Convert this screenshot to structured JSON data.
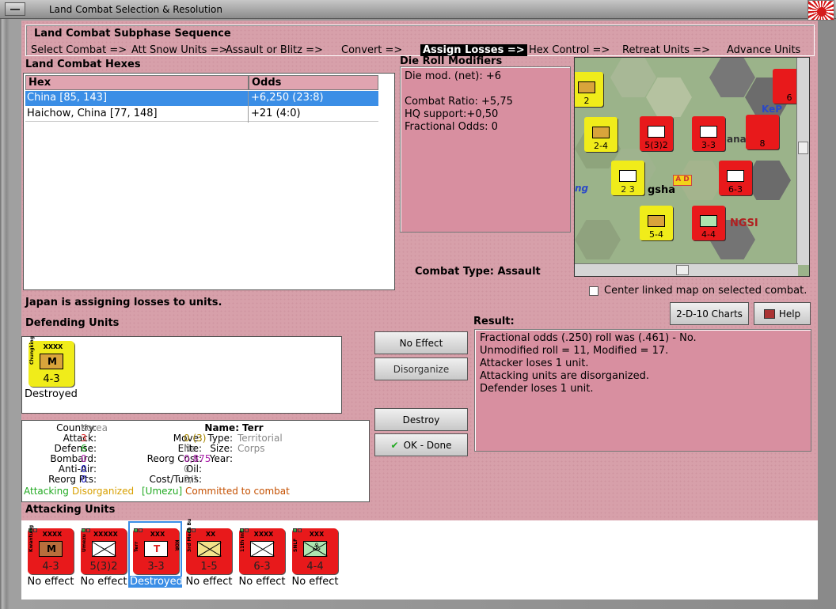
{
  "window": {
    "title": "Land Combat Selection & Resolution"
  },
  "sequence": {
    "title": "Land Combat Subphase Sequence",
    "steps": [
      "Select Combat =>",
      "Att Snow Units =>",
      "Assault or Blitz =>",
      "Convert =>",
      "Assign Losses =>",
      "Hex Control =>",
      "Retreat Units =>",
      "Advance Units"
    ],
    "active_index": 4
  },
  "hexes": {
    "title": "Land Combat Hexes",
    "columns": [
      "Hex",
      "Odds"
    ],
    "rows": [
      {
        "hex": "China [85, 143]",
        "odds": "+6,250 (23:8)"
      },
      {
        "hex": "Haichow, China [77, 148]",
        "odds": "+21 (4:0)"
      }
    ]
  },
  "die_roll": {
    "title": "Die Roll Modifiers",
    "lines": [
      "Die mod. (net): +6",
      "",
      "Combat Ratio: +5,75",
      "HQ support:+0,50",
      "Fractional Odds: 0"
    ]
  },
  "combat_type": {
    "label": "Combat Type:",
    "value": "Assault"
  },
  "center_map": {
    "label": "Center linked map on selected combat."
  },
  "status_message": "Japan is assigning losses to units.",
  "defending": {
    "title": "Defending Units",
    "units": [
      {
        "name": "Chungking",
        "size": "XXXX",
        "strength": "4-3",
        "state": "Destroyed",
        "color": "yellow"
      }
    ]
  },
  "detail": {
    "country_label": "Country:",
    "country": "Korea",
    "attack_label": "Attack:",
    "attack": "3",
    "defense_label": "Defense:",
    "defense": "6",
    "bombard_label": "Bombard:",
    "bombard": "0",
    "antiair_label": "Anti-Air:",
    "antiair": "0",
    "reorg_label": "Reorg Pts:",
    "reorg": "0",
    "name_label": "Name:",
    "name": "Terr",
    "move_label": "Move:",
    "move": "0 (3)",
    "type_label": "Type:",
    "type": "Territorial",
    "elite_label": "Elite:",
    "elite": "No",
    "size_label": "Size:",
    "size": "Corps",
    "reorgcost_label": "Reorg Cost:",
    "reorgcost": "0,875",
    "year_label": "Year:",
    "year": "",
    "oil_label": "Oil:",
    "oil": "0",
    "cost_label": "Cost/Turns:",
    "cost": "2/1",
    "status_attacking": "Attacking",
    "status_disorg": "Disorganized",
    "status_hq": "[Umezu]",
    "status_commit": "Committed to combat"
  },
  "buttons": {
    "no_effect": "No Effect",
    "disorganize": "Disorganize",
    "destroy": "Destroy",
    "ok_done": "OK - Done",
    "charts": "2-D-10 Charts",
    "help": "Help"
  },
  "result": {
    "title": "Result:",
    "lines": [
      "Fractional odds (.250) roll was (.461)  - No.",
      "Unmodified roll = 11, Modified = 17.",
      "Attacker loses 1 unit.",
      "Attacking units are disorganized.",
      "Defender loses 1 unit."
    ]
  },
  "attacking": {
    "title": "Attacking Units",
    "units": [
      {
        "name": "Kwantung",
        "size": "XXXX",
        "strength": "4-3",
        "state": "No effect"
      },
      {
        "name": "Umezu",
        "size": "XXXXX",
        "strength": "5(3)2",
        "state": "No effect"
      },
      {
        "name": "Terr",
        "size": "XXX",
        "strength": "3-3",
        "state": "Destroyed",
        "suffix": "KOR"
      },
      {
        "name": "3rd Mech Bu",
        "size": "XX",
        "strength": "1-5",
        "state": "No effect"
      },
      {
        "name": "11th Inf",
        "size": "XXXX",
        "strength": "6-3",
        "state": "No effect"
      },
      {
        "name": "SNLF",
        "size": "XXX",
        "strength": "4-4",
        "state": "No effect"
      }
    ],
    "selected_index": 2
  },
  "map": {
    "labels": [
      "gsha",
      "NGSI",
      "ng",
      "ana",
      "KeP"
    ],
    "units": [
      {
        "strength": "2",
        "color": "yellow"
      },
      {
        "strength": "2-4",
        "color": "yellow"
      },
      {
        "strength": "5(3)2",
        "color": "red"
      },
      {
        "strength": "3-3",
        "color": "red"
      },
      {
        "strength": "2 3",
        "color": "yellow"
      },
      {
        "strength": "6-3",
        "color": "red"
      },
      {
        "strength": "5-4",
        "color": "yellow"
      },
      {
        "strength": "4-4",
        "color": "red"
      },
      {
        "strength": "6",
        "color": "red"
      },
      {
        "strength": "8",
        "color": "red"
      }
    ],
    "combat_marker": "A D"
  }
}
